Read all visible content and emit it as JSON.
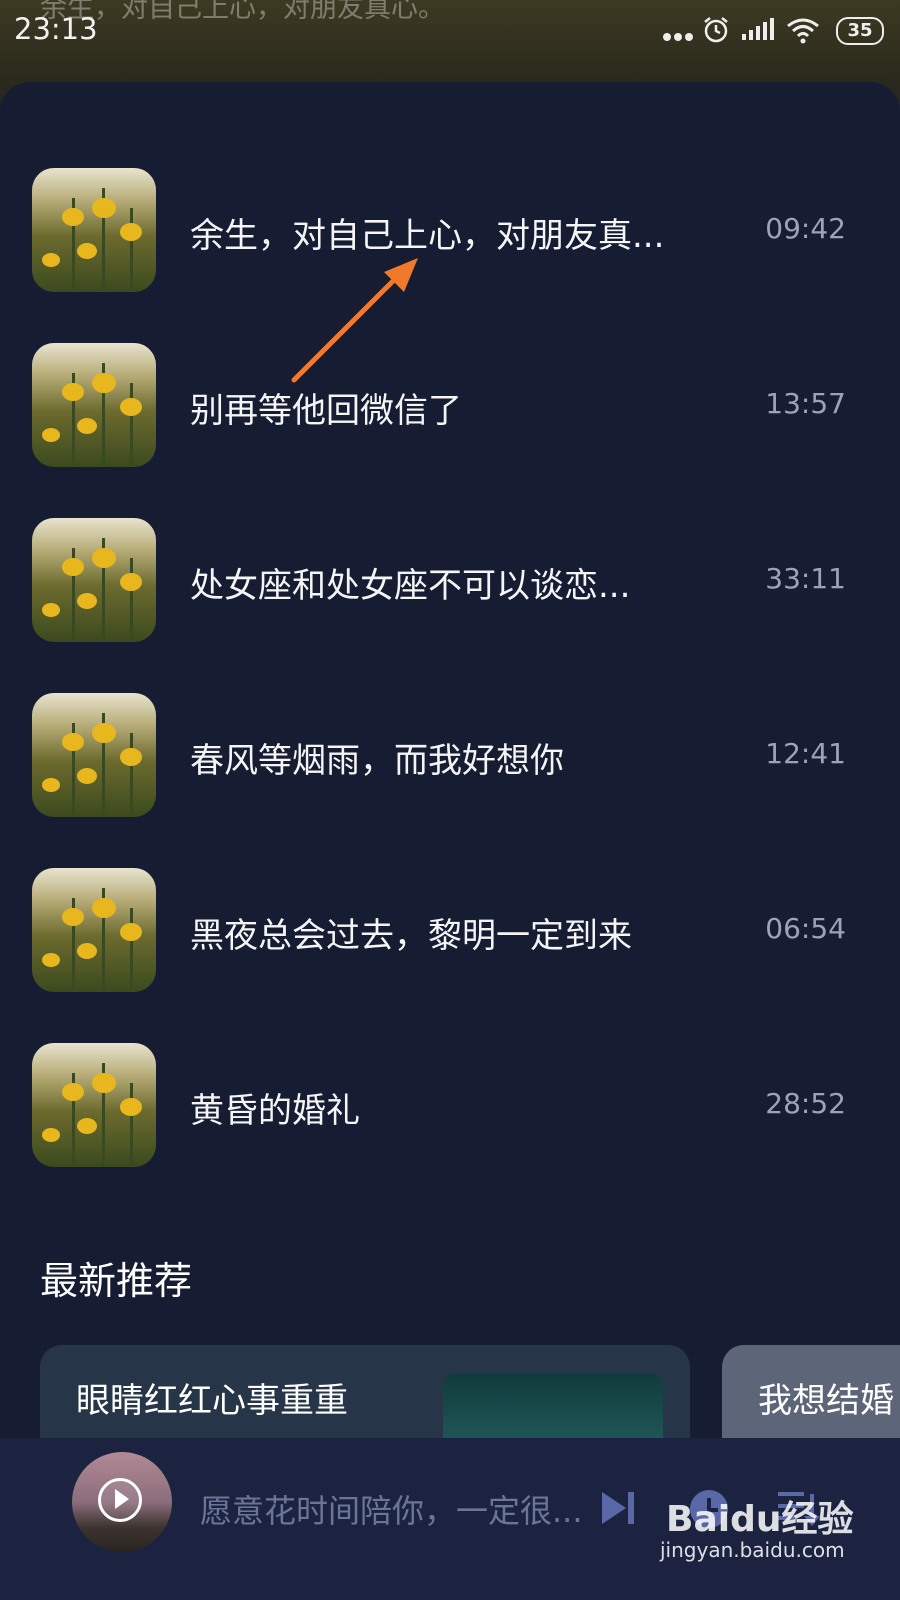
{
  "status_bar": {
    "time": "23:13",
    "battery": "35",
    "faded_title": "余生，对自己上心，对朋友真心。"
  },
  "playlist": [
    {
      "title": "余生，对自己上心，对朋友真...",
      "duration": "09:42"
    },
    {
      "title": "别再等他回微信了",
      "duration": "13:57"
    },
    {
      "title": "处女座和处女座不可以谈恋...",
      "duration": "33:11"
    },
    {
      "title": "春风等烟雨，而我好想你",
      "duration": "12:41"
    },
    {
      "title": "黑夜总会过去，黎明一定到来",
      "duration": "06:54"
    },
    {
      "title": "黄昏的婚礼",
      "duration": "28:52"
    }
  ],
  "recommend": {
    "title": "最新推荐",
    "cards": [
      {
        "title": "眼睛红红心事重重"
      },
      {
        "title": "我想结婚"
      }
    ]
  },
  "player": {
    "now_playing": "愿意花时间陪你，一定很..."
  },
  "watermark": {
    "main": "Baidu经验",
    "sub": "jingyan.baidu.com"
  },
  "colors": {
    "panel_bg": "#161d33",
    "player_bg": "#1b2341",
    "arrow": "#f07a2a",
    "icon_blue": "#5a68a8"
  },
  "icons": [
    "wifi-icon",
    "signal-icon",
    "alarm-icon",
    "more-dots-icon",
    "battery-icon",
    "play-icon",
    "next-track-icon",
    "timer-icon",
    "playlist-icon"
  ]
}
